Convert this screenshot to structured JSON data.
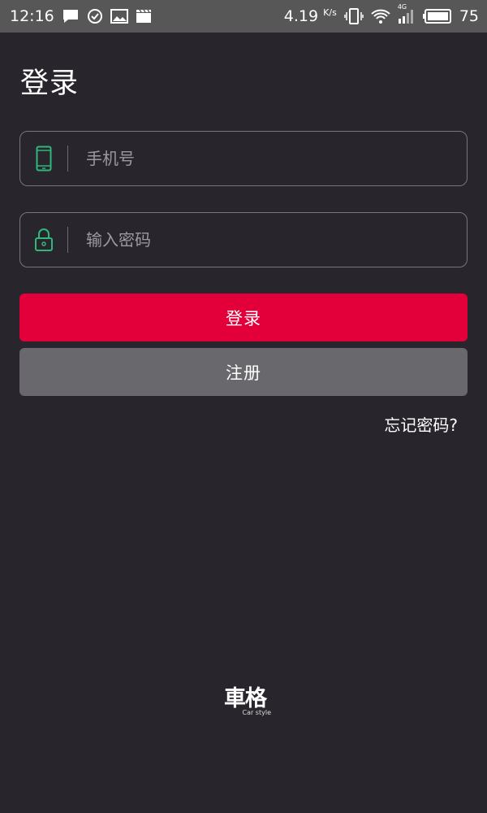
{
  "status_bar": {
    "time": "12:16",
    "network_speed": "4.19",
    "network_speed_unit": "K/s",
    "network_type": "4G",
    "battery": "75",
    "left_icons": [
      "message-icon",
      "check-circle-icon",
      "image-icon",
      "clapper-icon"
    ],
    "right_icons": [
      "vibrate-icon",
      "wifi-icon",
      "signal-icon",
      "battery-icon"
    ]
  },
  "page": {
    "title": "登录"
  },
  "form": {
    "phone": {
      "placeholder": "手机号",
      "value": "",
      "icon": "phone-icon",
      "icon_color": "#2fb87a"
    },
    "password": {
      "placeholder": "输入密码",
      "value": "",
      "icon": "lock-icon",
      "icon_color": "#2fb87a"
    }
  },
  "buttons": {
    "login": {
      "label": "登录",
      "color": "#e3003a"
    },
    "register": {
      "label": "注册",
      "color": "#69686d"
    }
  },
  "links": {
    "forgot_password": "忘记密码?"
  },
  "logo": {
    "main": "車格",
    "sub": "Car style"
  }
}
